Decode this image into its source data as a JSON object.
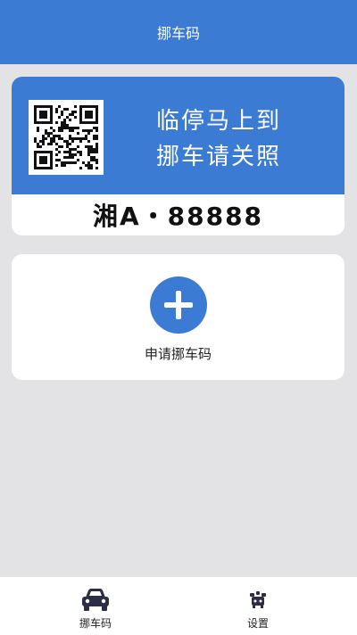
{
  "header": {
    "title": "挪车码"
  },
  "code_card": {
    "slogan_line1": "临停马上到",
    "slogan_line2": "挪车请关照",
    "plate": "湘A・88888"
  },
  "apply_card": {
    "label": "申请挪车码"
  },
  "tabbar": {
    "items": [
      {
        "label": "挪车码",
        "icon": "car-icon"
      },
      {
        "label": "设置",
        "icon": "settings-icon"
      }
    ]
  },
  "colors": {
    "brand": "#3b7bd4",
    "background": "#e3e2e4"
  }
}
